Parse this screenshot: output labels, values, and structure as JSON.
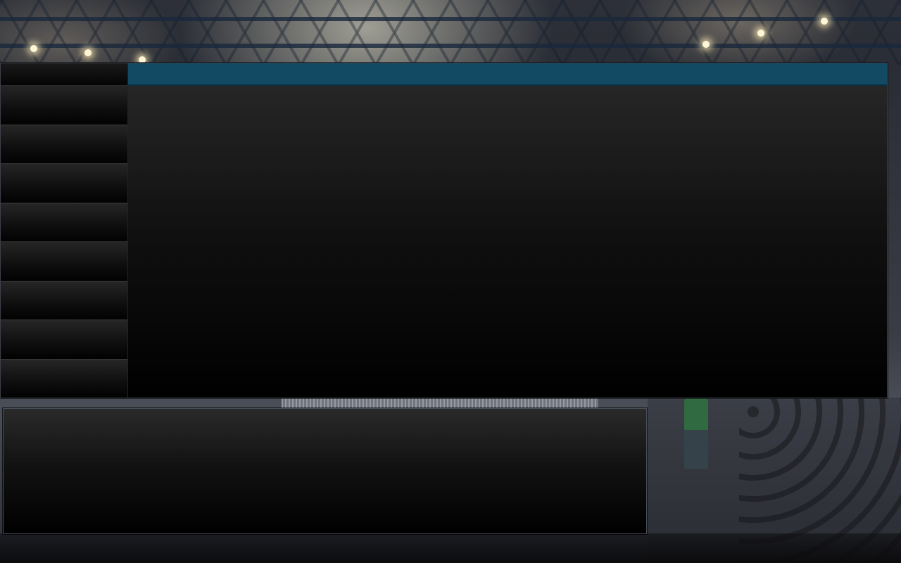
{
  "screen": {
    "title": ""
  },
  "menu": {
    "header_label": "",
    "items": [
      {
        "label": ""
      },
      {
        "label": ""
      },
      {
        "label": ""
      },
      {
        "label": ""
      },
      {
        "label": ""
      },
      {
        "label": ""
      },
      {
        "label": ""
      },
      {
        "label": ""
      }
    ]
  },
  "content": {
    "header_title": "",
    "body_text": ""
  },
  "info_panel": {
    "text": ""
  },
  "colors": {
    "header_accent": "#124963",
    "panel_black": "#000000",
    "panel_border": "#3c4148"
  }
}
